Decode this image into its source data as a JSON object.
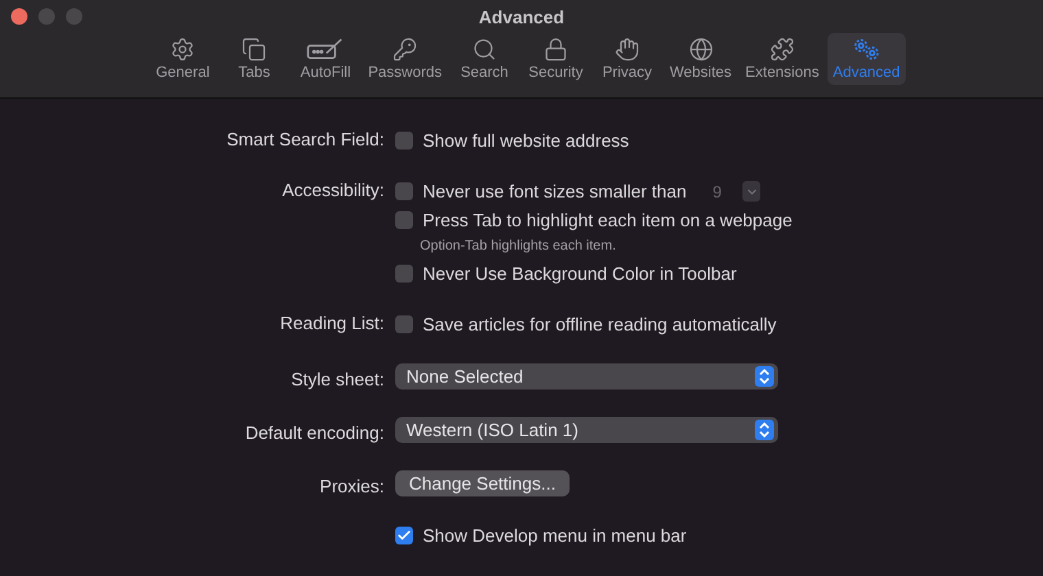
{
  "window": {
    "title": "Advanced"
  },
  "toolbar": [
    {
      "kind": "general",
      "label": "General",
      "selected": false
    },
    {
      "kind": "tabs",
      "label": "Tabs",
      "selected": false
    },
    {
      "kind": "autofill",
      "label": "AutoFill",
      "selected": false
    },
    {
      "kind": "passwords",
      "label": "Passwords",
      "selected": false
    },
    {
      "kind": "search",
      "label": "Search",
      "selected": false
    },
    {
      "kind": "security",
      "label": "Security",
      "selected": false
    },
    {
      "kind": "privacy",
      "label": "Privacy",
      "selected": false
    },
    {
      "kind": "websites",
      "label": "Websites",
      "selected": false
    },
    {
      "kind": "extensions",
      "label": "Extensions",
      "selected": false
    },
    {
      "kind": "advanced",
      "label": "Advanced",
      "selected": true
    }
  ],
  "sections": [
    {
      "label": "Smart Search Field:",
      "items": [
        {
          "kind": "checkbox",
          "label": "Show full website address",
          "checked": false
        }
      ]
    },
    {
      "label": "Accessibility:",
      "items": [
        {
          "kind": "checkbox",
          "label": "Never use font sizes smaller than",
          "checked": false,
          "stepper": {
            "value": "9",
            "disabled": true
          }
        },
        {
          "kind": "checkbox",
          "label": "Press Tab to highlight each item on a webpage",
          "checked": false
        },
        {
          "kind": "hint",
          "label": "Option-Tab highlights each item."
        },
        {
          "kind": "checkbox",
          "label": "Never Use Background Color in Toolbar",
          "checked": false
        }
      ]
    },
    {
      "label": "Reading List:",
      "items": [
        {
          "kind": "checkbox",
          "label": "Save articles for offline reading automatically",
          "checked": false
        }
      ]
    },
    {
      "label": "Style sheet:",
      "items": [
        {
          "kind": "popup",
          "label": "None Selected"
        }
      ]
    },
    {
      "label": "Default encoding:",
      "items": [
        {
          "kind": "popup",
          "label": "Western (ISO Latin 1)"
        }
      ]
    },
    {
      "label": "Proxies:",
      "items": [
        {
          "kind": "button",
          "label": "Change Settings..."
        }
      ]
    },
    {
      "items": [
        {
          "kind": "checkbox",
          "label": "Show Develop menu in menu bar",
          "checked": true
        }
      ]
    }
  ]
}
